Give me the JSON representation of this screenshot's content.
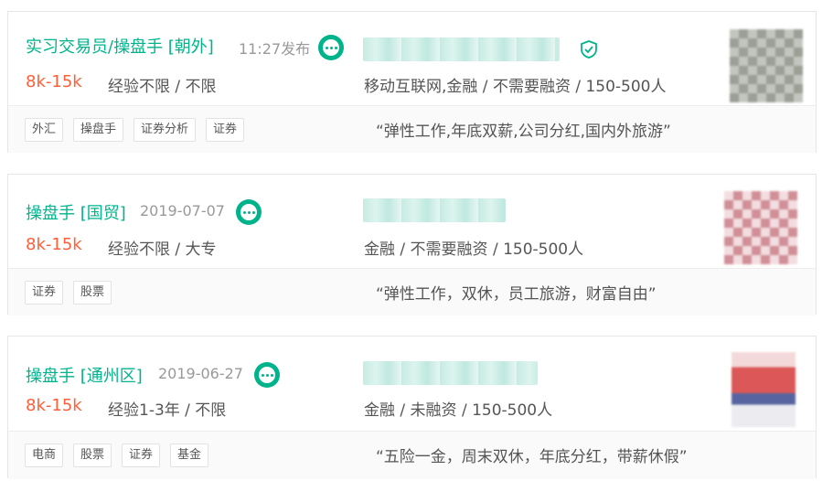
{
  "jobs": [
    {
      "title": "实习交易员/操盘手 [朝外]",
      "time": "11:27发布",
      "salary": "8k-15k",
      "requirements": "经验不限 / 不限",
      "industry": "移动互联网,金融 / 不需要融资 / 150-500人",
      "tags": [
        "外汇",
        "操盘手",
        "证券分析",
        "证券"
      ],
      "welfare": "“弹性工作,年底双薪,公司分红,国内外旅游”"
    },
    {
      "title": "操盘手 [国贸]",
      "time": "2019-07-07",
      "salary": "8k-15k",
      "requirements": "经验不限 / 大专",
      "industry": "金融 / 不需要融资 / 150-500人",
      "tags": [
        "证券",
        "股票"
      ],
      "welfare": "“弹性工作，双休，员工旅游，财富自由”"
    },
    {
      "title": "操盘手 [通州区]",
      "time": "2019-06-27",
      "salary": "8k-15k",
      "requirements": "经验1-3年 / 不限",
      "industry": "金融 / 未融资 / 150-500人",
      "tags": [
        "电商",
        "股票",
        "证券",
        "基金"
      ],
      "welfare": "“五险一金，周末双休，年底分红，带薪休假”"
    }
  ],
  "colors": {
    "accent": "#00b38a",
    "salary": "#fd5f39"
  },
  "icons": {
    "chat": "chat-bubble-icon",
    "verified": "verified-shield-icon"
  }
}
